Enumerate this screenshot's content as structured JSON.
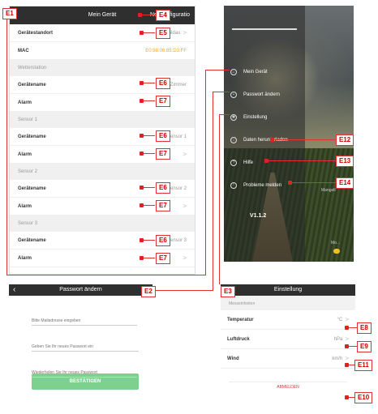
{
  "device_panel": {
    "back": "‹",
    "title": "Mein Gerät",
    "reset": "Neukonfiguratio",
    "rows": [
      {
        "label": "Gerätestandort",
        "value": "Wildau",
        "chev": ">"
      },
      {
        "label": "MAC",
        "value": "E0:98:06:85:D3:FF",
        "chev": ""
      }
    ],
    "weather": {
      "section": "Wetterstation",
      "name_label": "Gerätename",
      "name_value": "Im Zimmer",
      "alarm_label": "Alarm"
    },
    "sensors": [
      {
        "section": "Sensor 1",
        "name_label": "Gerätename",
        "name_value": "Sensor 1",
        "alarm_label": "Alarm"
      },
      {
        "section": "Sensor 2",
        "name_label": "Gerätename",
        "name_value": "Sensor 2",
        "alarm_label": "Alarm"
      },
      {
        "section": "Sensor 3",
        "name_label": "Gerätename",
        "name_value": "Sensor 3",
        "alarm_label": "Alarm"
      }
    ]
  },
  "menu_panel": {
    "items": [
      {
        "label": "Mein Gerät",
        "icon": "home-icon"
      },
      {
        "label": "Passwort ändern",
        "icon": "lock-icon"
      },
      {
        "label": "Einstellung",
        "icon": "gear-icon"
      },
      {
        "label": "Daten herunterladen",
        "icon": "download-icon"
      },
      {
        "label": "Hilfe",
        "icon": "help-icon"
      },
      {
        "label": "Probleme melden",
        "icon": "report-icon"
      }
    ],
    "version": "V1.1.2",
    "right_labels": [
      "Mangelt",
      "Mo..."
    ]
  },
  "password_panel": {
    "back": "‹",
    "title": "Passwort ändern",
    "email_placeholder": "Bitte Mailadresse eingeben",
    "new_pw_placeholder": "Geben Sie Ihr neues Passwort ein",
    "repeat_pw_placeholder": "Wiederholen Sie Ihr neues Passwort",
    "confirm": "BESTÄTIGEN"
  },
  "settings_panel": {
    "title": "Einstellung",
    "section": "Messeinheiten",
    "rows": [
      {
        "label": "Temperatur",
        "value": "°C"
      },
      {
        "label": "Luftdruck",
        "value": "hPa"
      },
      {
        "label": "Wind",
        "value": "km/h"
      }
    ],
    "logout": "ABMELDEN"
  },
  "callouts": {
    "E1": "E1",
    "E2": "E2",
    "E3": "E3",
    "E4": "E4",
    "E5": "E5",
    "E6": "E6",
    "E7": "E7",
    "E8": "E8",
    "E9": "E9",
    "E10": "E10",
    "E11": "E11",
    "E12": "E12",
    "E13": "E13",
    "E14": "E14"
  },
  "colors": {
    "accent_red": "#d33333",
    "header_dark": "#2f2f2f",
    "confirm_green": "#7ed08e",
    "mac_orange": "#f5a623"
  }
}
